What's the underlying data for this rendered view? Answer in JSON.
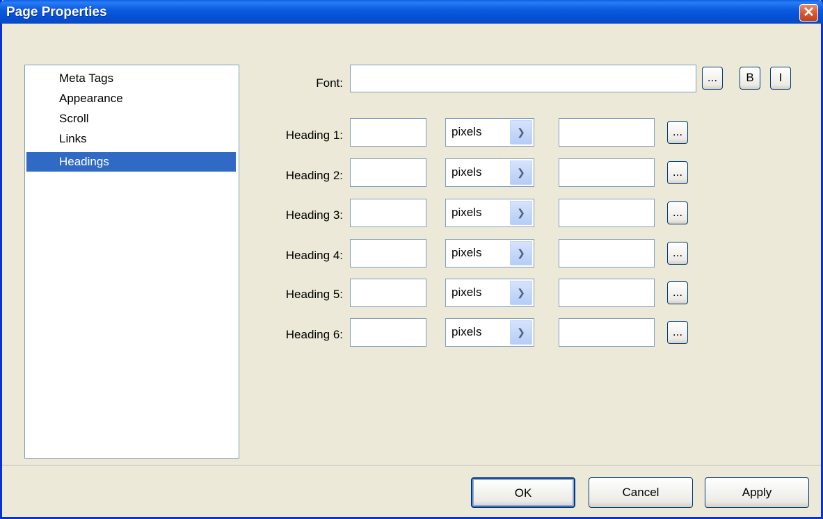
{
  "dialog": {
    "title": "Page Properties",
    "close_symbol": "✕"
  },
  "sidebar": {
    "items": [
      {
        "label": "Meta Tags"
      },
      {
        "label": "Appearance"
      },
      {
        "label": "Scroll"
      },
      {
        "label": "Links"
      },
      {
        "label": "Headings"
      }
    ],
    "selected": "Headings"
  },
  "font": {
    "label": "Font:",
    "value": "",
    "browse_label": "...",
    "bold_label": "B",
    "italic_label": "I"
  },
  "headings": [
    {
      "label": "Heading 1:",
      "size": "",
      "unit": "pixels",
      "color": "",
      "browse_label": "..."
    },
    {
      "label": "Heading 2:",
      "size": "",
      "unit": "pixels",
      "color": "",
      "browse_label": "..."
    },
    {
      "label": "Heading 3:",
      "size": "",
      "unit": "pixels",
      "color": "",
      "browse_label": "..."
    },
    {
      "label": "Heading 4:",
      "size": "",
      "unit": "pixels",
      "color": "",
      "browse_label": "..."
    },
    {
      "label": "Heading 5:",
      "size": "",
      "unit": "pixels",
      "color": "",
      "browse_label": "..."
    },
    {
      "label": "Heading 6:",
      "size": "",
      "unit": "pixels",
      "color": "",
      "browse_label": "..."
    }
  ],
  "buttons": {
    "ok": "OK",
    "cancel": "Cancel",
    "apply": "Apply"
  },
  "colors": {
    "titlebar": "#0551d6",
    "selection": "#316ac5",
    "dialog_bg": "#ece9d8"
  }
}
